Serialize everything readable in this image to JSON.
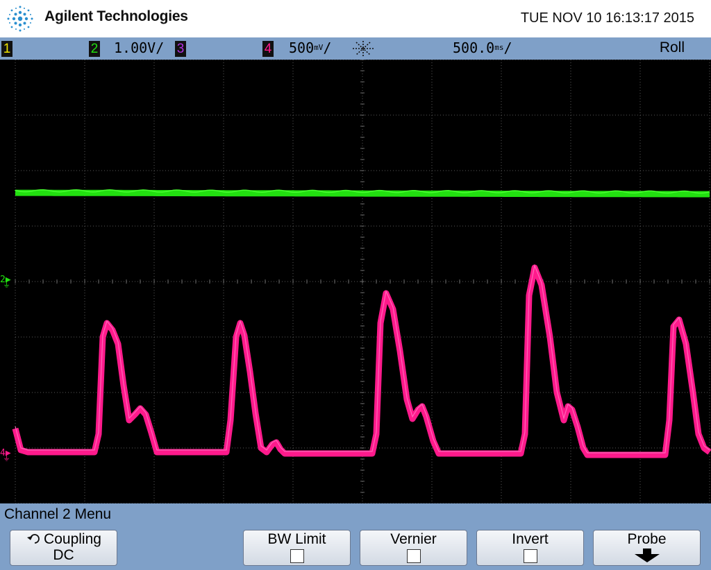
{
  "header": {
    "brand": "Agilent Technologies",
    "datetime": "TUE NOV 10 16:13:17 2015"
  },
  "status": {
    "ch1": "1",
    "ch2": "2",
    "ch2_scale": "1.00V/",
    "ch3": "3",
    "ch4": "4",
    "ch4_scale": "500",
    "ch4_unit": "mV",
    "ch4_suffix": "/",
    "timebase": "500.0",
    "timebase_unit": "ms",
    "timebase_suffix": "/",
    "mode": "Roll",
    "colors": {
      "ch1": "#f2e600",
      "ch2": "#22e010",
      "ch3": "#b030e0",
      "ch4": "#ff1a8c"
    }
  },
  "markers": {
    "ch2": "2",
    "ch4": "4"
  },
  "menu": {
    "title": "Channel 2  Menu",
    "softkeys": [
      {
        "label": "Coupling",
        "value": "DC",
        "icon": "cycle-icon"
      },
      {
        "label": "BW Limit",
        "checked": false
      },
      {
        "label": "Vernier",
        "checked": false
      },
      {
        "label": "Invert",
        "checked": false
      },
      {
        "label": "Probe",
        "icon": "down-arrow-icon"
      }
    ]
  }
}
